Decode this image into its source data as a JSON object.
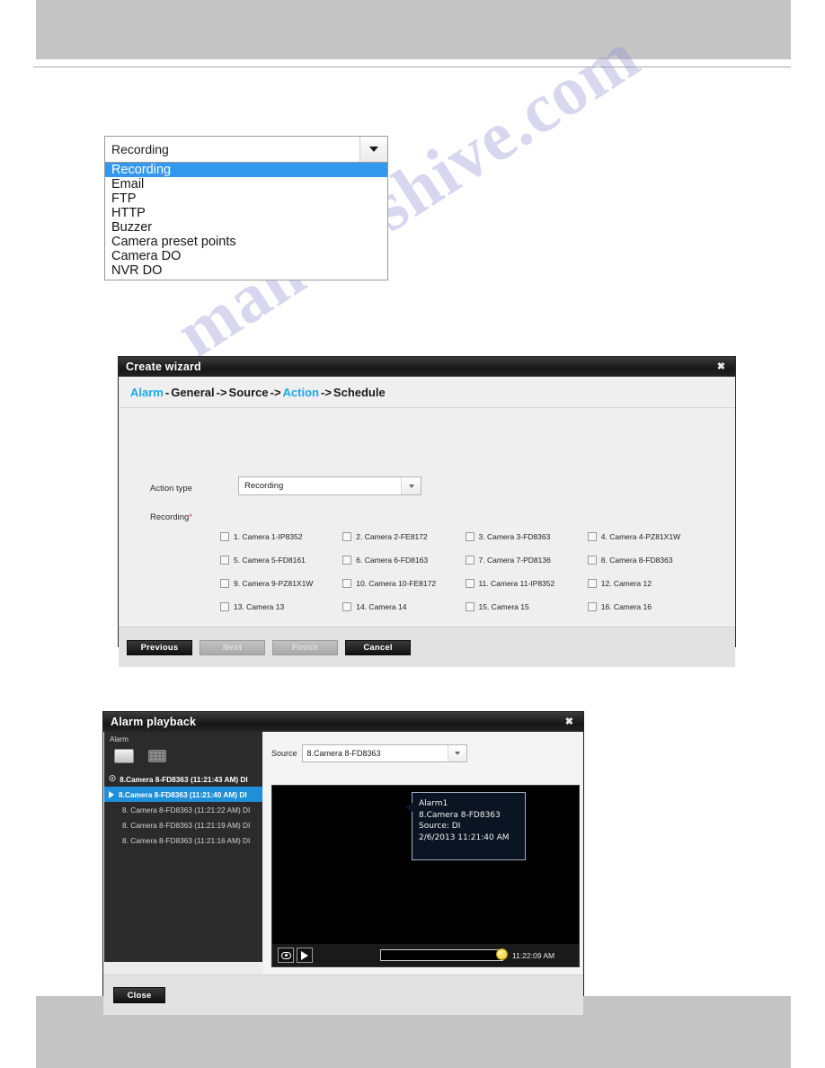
{
  "watermark": {
    "text": "manualshive.com"
  },
  "action_dropdown": {
    "selected": "Recording",
    "options": [
      "Recording",
      "Email",
      "FTP",
      "HTTP",
      "Buzzer",
      "Camera preset points",
      "Camera DO",
      "NVR DO"
    ]
  },
  "wizard": {
    "title": "Create wizard",
    "close_label": "✖",
    "breadcrumb": {
      "step1": "Alarm",
      "dash": "-",
      "step2": "General",
      "arrow1": "->",
      "step3": "Source",
      "arrow2": "->",
      "step4": "Action",
      "arrow3": "->",
      "step5": "Schedule"
    },
    "action_type_label": "Action type",
    "action_type_value": "Recording",
    "recording_label": "Recording",
    "required_mark": "*",
    "cameras": [
      "1. Camera 1-IP8352",
      "2. Camera 2-FE8172",
      "3. Camera 3-FD8363",
      "4. Camera 4-PZ81X1W",
      "5. Camera 5-FD8161",
      "6. Camera 6-FD8163",
      "7. Camera 7-PD8136",
      "8. Camera 8-FD8363",
      "9. Camera 9-PZ81X1W",
      "10. Camera 10-FE8172",
      "11. Camera 11-IP8352",
      "12. Camera 12",
      "13. Camera 13",
      "14. Camera 14",
      "15. Camera 15",
      "16. Camera 16"
    ],
    "buttons": {
      "previous": "Previous",
      "next": "Next",
      "finish": "Finish",
      "cancel": "Cancel"
    }
  },
  "playback": {
    "title": "Alarm playback",
    "close_label": "✖",
    "sidebar_title": "Alarm",
    "alarms": [
      {
        "text": "8.Camera 8-FD8363 (11:21:43 AM) DI",
        "state": "head"
      },
      {
        "text": "8.Camera 8-FD8363 (11:21:40 AM) DI",
        "state": "selected"
      },
      {
        "text": "8. Camera 8-FD8363 (11:21:22 AM) DI",
        "state": "plain"
      },
      {
        "text": "8. Camera 8-FD8363 (11:21:19 AM) DI",
        "state": "plain"
      },
      {
        "text": "8. Camera 8-FD8363 (11:21:16 AM) DI",
        "state": "plain"
      }
    ],
    "source_label": "Source",
    "source_value": "8.Camera 8-FD8363",
    "tooltip": {
      "line1": "Alarm1",
      "line2": "8.Camera 8-FD8363",
      "line3": "Source: DI",
      "line4": "2/6/2013 11:21:40 AM"
    },
    "timeline_time": "11:22:09 AM",
    "close_button": "Close"
  },
  "colors": {
    "accent_blue": "#1aa9e8",
    "selection_blue": "#3399ef",
    "list_selection": "#1e8fd8",
    "required_red": "#e03030",
    "page_band": "#c4c4c4"
  }
}
